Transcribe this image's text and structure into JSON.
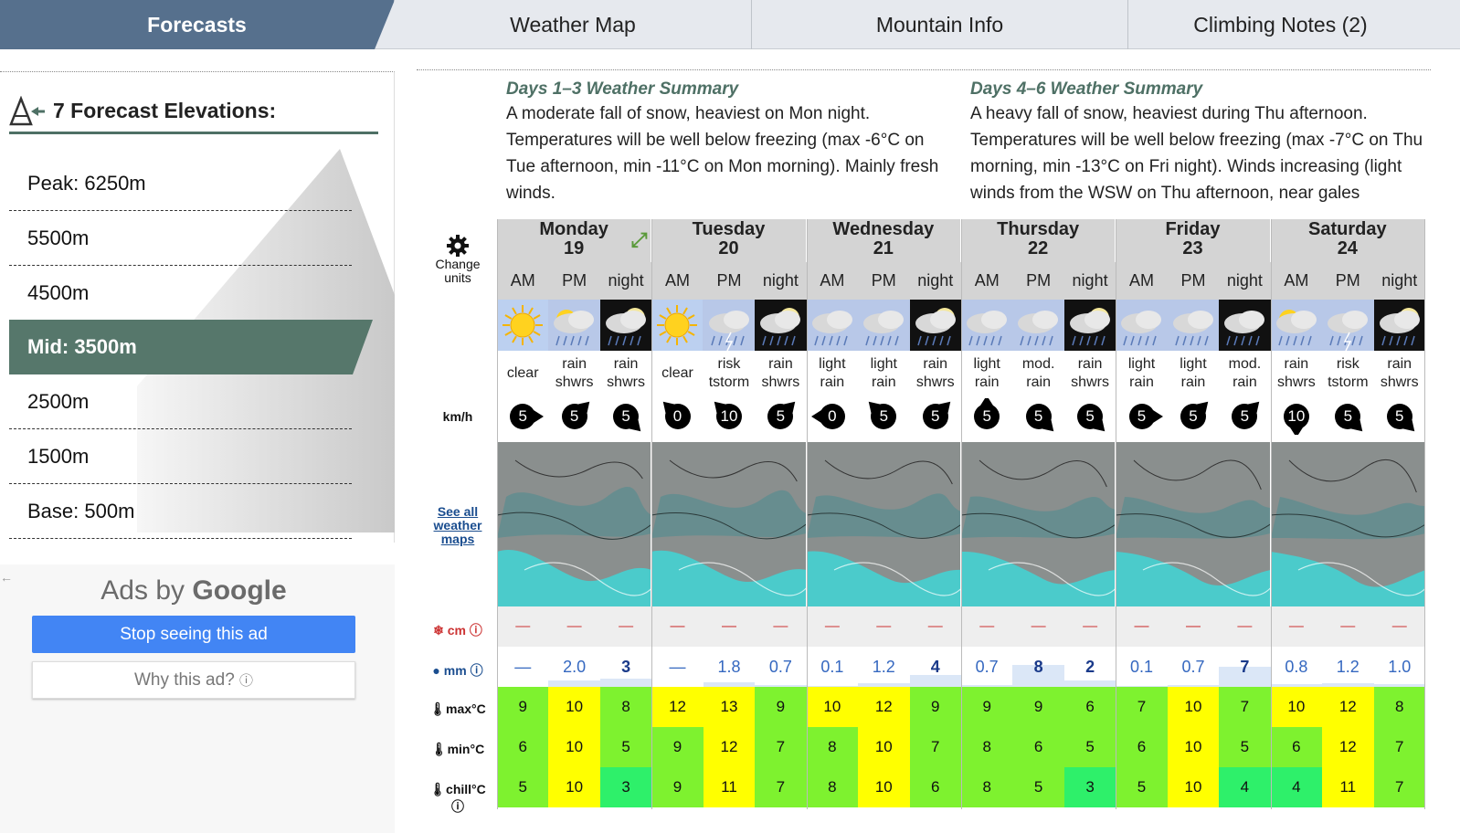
{
  "tabs": [
    "Forecasts",
    "Weather Map",
    "Mountain Info",
    "Climbing Notes (2)"
  ],
  "elevations": {
    "title": "7 Forecast Elevations:",
    "items": [
      "Peak: 6250m",
      "5500m",
      "4500m",
      "Mid: 3500m",
      "2500m",
      "1500m",
      "Base: 500m"
    ],
    "selected_index": 3
  },
  "ads": {
    "ads_by": "Ads by",
    "google": "Google",
    "stop": "Stop seeing this ad",
    "why": "Why this ad?"
  },
  "summary": [
    {
      "title": "Days 1–3 Weather Summary",
      "text": "A moderate fall of snow, heaviest on Mon night. Temperatures will be well below freezing (max -6°C on Tue afternoon, min -11°C on Mon morning). Mainly fresh winds."
    },
    {
      "title": "Days 4–6 Weather Summary",
      "text": "A heavy fall of snow, heaviest during Thu afternoon. Temperatures will be well below freezing (max -7°C on Thu morning, min -13°C on Fri night). Winds increasing (light winds from the WSW on Thu afternoon, near gales"
    }
  ],
  "labels": {
    "change_units": "Change units",
    "kmh": "km/h",
    "see_all": "See all weather maps",
    "cm": "cm",
    "mm": "mm",
    "max": "max°C",
    "min": "min°C",
    "chill": "chill°C"
  },
  "days": [
    {
      "name": "Monday",
      "date": "19"
    },
    {
      "name": "Tuesday",
      "date": "20"
    },
    {
      "name": "Wednesday",
      "date": "21"
    },
    {
      "name": "Thursday",
      "date": "22"
    },
    {
      "name": "Friday",
      "date": "23"
    },
    {
      "name": "Saturday",
      "date": "24"
    }
  ],
  "period_labels": [
    "AM",
    "PM",
    "night"
  ],
  "periods": [
    {
      "icon": "sun-icon",
      "night": false,
      "weather": "clear",
      "wind": "5",
      "wind_dir": "right",
      "snow": "—",
      "rain": "—",
      "rain_frac": 0,
      "max": "9",
      "min": "6",
      "chill": "5",
      "cmax": "#7ef22f",
      "cmin": "#7ef22f",
      "cchill": "#7ef22f"
    },
    {
      "icon": "sun-cloud-rain-icon",
      "night": false,
      "weather": "rain shwrs",
      "wind": "5",
      "wind_dir": "up-right",
      "snow": "—",
      "rain": "2.0",
      "rain_frac": 0.15,
      "max": "10",
      "min": "10",
      "chill": "10",
      "cmax": "#ffff00",
      "cmin": "#ffff00",
      "cchill": "#ffff00"
    },
    {
      "icon": "moon-cloud-rain-icon",
      "night": true,
      "weather": "rain shwrs",
      "wind": "5",
      "wind_dir": "down-right",
      "snow": "—",
      "rain": "3",
      "rain_frac": 0.2,
      "max": "8",
      "min": "5",
      "chill": "3",
      "cmax": "#7ef22f",
      "cmin": "#7ef22f",
      "cchill": "#2ef06a"
    },
    {
      "icon": "sun-icon",
      "night": false,
      "weather": "clear",
      "wind": "0",
      "wind_dir": "up-left",
      "snow": "—",
      "rain": "—",
      "rain_frac": 0,
      "max": "12",
      "min": "9",
      "chill": "9",
      "cmax": "#ffff00",
      "cmin": "#7ef22f",
      "cchill": "#7ef22f"
    },
    {
      "icon": "thunderstorm-icon",
      "night": false,
      "weather": "risk tstorm",
      "wind": "10",
      "wind_dir": "up-left",
      "snow": "—",
      "rain": "1.8",
      "rain_frac": 0.12,
      "max": "13",
      "min": "12",
      "chill": "11",
      "cmax": "#ffff00",
      "cmin": "#ffff00",
      "cchill": "#ffff00"
    },
    {
      "icon": "moon-cloud-rain-icon",
      "night": true,
      "weather": "rain shwrs",
      "wind": "5",
      "wind_dir": "up-right",
      "snow": "—",
      "rain": "0.7",
      "rain_frac": 0.05,
      "max": "9",
      "min": "7",
      "chill": "7",
      "cmax": "#7ef22f",
      "cmin": "#7ef22f",
      "cchill": "#7ef22f"
    },
    {
      "icon": "cloud-rain-icon",
      "night": false,
      "weather": "light rain",
      "wind": "0",
      "wind_dir": "left",
      "snow": "—",
      "rain": "0.1",
      "rain_frac": 0.02,
      "max": "10",
      "min": "8",
      "chill": "8",
      "cmax": "#ffff00",
      "cmin": "#7ef22f",
      "cchill": "#7ef22f"
    },
    {
      "icon": "cloud-rain-icon",
      "night": false,
      "weather": "light rain",
      "wind": "5",
      "wind_dir": "up-left",
      "snow": "—",
      "rain": "1.2",
      "rain_frac": 0.08,
      "max": "12",
      "min": "10",
      "chill": "10",
      "cmax": "#ffff00",
      "cmin": "#ffff00",
      "cchill": "#ffff00"
    },
    {
      "icon": "moon-cloud-rain-icon",
      "night": true,
      "weather": "rain shwrs",
      "wind": "5",
      "wind_dir": "up-right",
      "snow": "—",
      "rain": "4",
      "rain_frac": 0.3,
      "max": "9",
      "min": "7",
      "chill": "6",
      "cmax": "#7ef22f",
      "cmin": "#7ef22f",
      "cchill": "#7ef22f"
    },
    {
      "icon": "cloud-rain-icon",
      "night": false,
      "weather": "light rain",
      "wind": "5",
      "wind_dir": "up",
      "snow": "—",
      "rain": "0.7",
      "rain_frac": 0.05,
      "max": "9",
      "min": "8",
      "chill": "8",
      "cmax": "#7ef22f",
      "cmin": "#7ef22f",
      "cchill": "#7ef22f"
    },
    {
      "icon": "cloud-rain-icon",
      "night": false,
      "weather": "mod. rain",
      "wind": "5",
      "wind_dir": "down-right",
      "snow": "—",
      "rain": "8",
      "rain_frac": 0.55,
      "max": "9",
      "min": "6",
      "chill": "5",
      "cmax": "#7ef22f",
      "cmin": "#7ef22f",
      "cchill": "#7ef22f"
    },
    {
      "icon": "moon-cloud-rain-icon",
      "night": true,
      "weather": "rain shwrs",
      "wind": "5",
      "wind_dir": "down-right",
      "snow": "—",
      "rain": "2",
      "rain_frac": 0.15,
      "max": "6",
      "min": "5",
      "chill": "3",
      "cmax": "#7ef22f",
      "cmin": "#7ef22f",
      "cchill": "#2ef06a"
    },
    {
      "icon": "cloud-rain-icon",
      "night": false,
      "weather": "light rain",
      "wind": "5",
      "wind_dir": "right",
      "snow": "—",
      "rain": "0.1",
      "rain_frac": 0.02,
      "max": "7",
      "min": "6",
      "chill": "5",
      "cmax": "#7ef22f",
      "cmin": "#7ef22f",
      "cchill": "#7ef22f"
    },
    {
      "icon": "cloud-rain-icon",
      "night": false,
      "weather": "light rain",
      "wind": "5",
      "wind_dir": "up-right",
      "snow": "—",
      "rain": "0.7",
      "rain_frac": 0.05,
      "max": "10",
      "min": "10",
      "chill": "10",
      "cmax": "#ffff00",
      "cmin": "#ffff00",
      "cchill": "#ffff00"
    },
    {
      "icon": "night-cloud-rain-icon",
      "night": true,
      "weather": "mod. rain",
      "wind": "5",
      "wind_dir": "up-right",
      "snow": "—",
      "rain": "7",
      "rain_frac": 0.5,
      "max": "7",
      "min": "5",
      "chill": "4",
      "cmax": "#7ef22f",
      "cmin": "#7ef22f",
      "cchill": "#2ef06a"
    },
    {
      "icon": "sun-cloud-rain-icon",
      "night": false,
      "weather": "rain shwrs",
      "wind": "10",
      "wind_dir": "down",
      "snow": "—",
      "rain": "0.8",
      "rain_frac": 0.06,
      "max": "10",
      "min": "6",
      "chill": "4",
      "cmax": "#ffff00",
      "cmin": "#7ef22f",
      "cchill": "#2ef06a"
    },
    {
      "icon": "thunderstorm-icon",
      "night": false,
      "weather": "risk tstorm",
      "wind": "5",
      "wind_dir": "down-right",
      "snow": "—",
      "rain": "1.2",
      "rain_frac": 0.08,
      "max": "12",
      "min": "12",
      "chill": "11",
      "cmax": "#ffff00",
      "cmin": "#ffff00",
      "cchill": "#ffff00"
    },
    {
      "icon": "moon-cloud-rain-icon",
      "night": true,
      "weather": "rain shwrs",
      "wind": "5",
      "wind_dir": "down-right",
      "snow": "—",
      "rain": "1.0",
      "rain_frac": 0.07,
      "max": "8",
      "min": "7",
      "chill": "7",
      "cmax": "#7ef22f",
      "cmin": "#7ef22f",
      "cchill": "#7ef22f"
    }
  ]
}
